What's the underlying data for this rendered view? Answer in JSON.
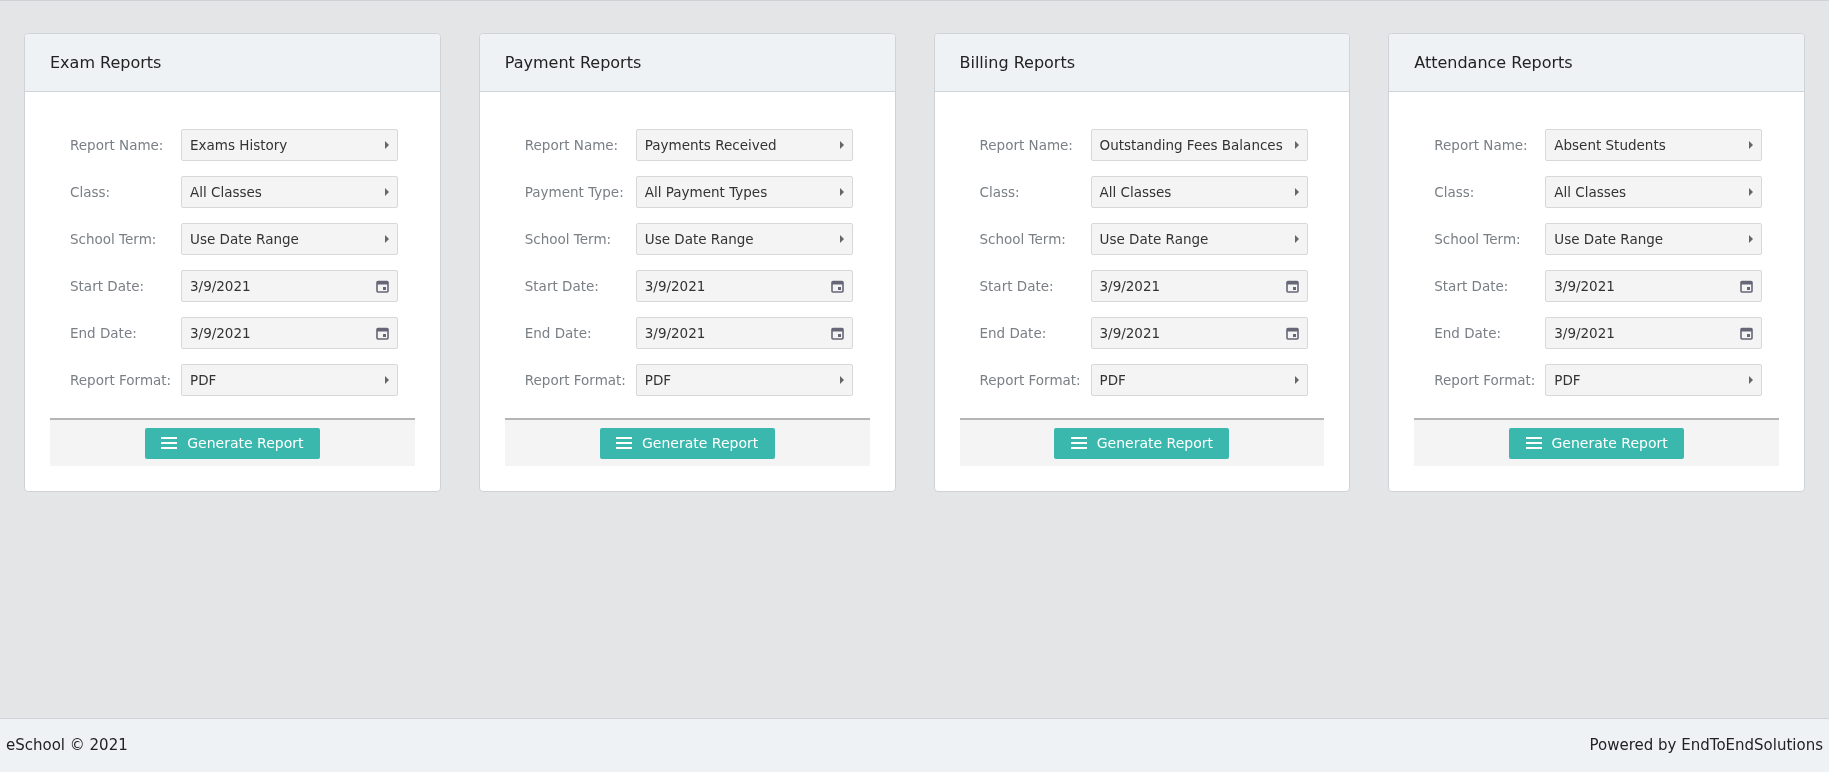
{
  "cards": [
    {
      "title": "Exam Reports",
      "fields": [
        {
          "label": "Report Name:",
          "kind": "select",
          "value": "Exams History"
        },
        {
          "label": "Class:",
          "kind": "select",
          "value": "All Classes"
        },
        {
          "label": "School Term:",
          "kind": "select",
          "value": "Use Date Range"
        },
        {
          "label": "Start Date:",
          "kind": "date",
          "value": "3/9/2021"
        },
        {
          "label": "End Date:",
          "kind": "date",
          "value": "3/9/2021"
        },
        {
          "label": "Report Format:",
          "kind": "select",
          "value": "PDF"
        }
      ],
      "button": "Generate Report"
    },
    {
      "title": "Payment Reports",
      "fields": [
        {
          "label": "Report Name:",
          "kind": "select",
          "value": "Payments Received"
        },
        {
          "label": "Payment Type:",
          "kind": "select",
          "value": "All Payment Types"
        },
        {
          "label": "School Term:",
          "kind": "select",
          "value": "Use Date Range"
        },
        {
          "label": "Start Date:",
          "kind": "date",
          "value": "3/9/2021"
        },
        {
          "label": "End Date:",
          "kind": "date",
          "value": "3/9/2021"
        },
        {
          "label": "Report Format:",
          "kind": "select",
          "value": "PDF"
        }
      ],
      "button": "Generate Report"
    },
    {
      "title": "Billing Reports",
      "fields": [
        {
          "label": "Report Name:",
          "kind": "select",
          "value": "Outstanding Fees Balances"
        },
        {
          "label": "Class:",
          "kind": "select",
          "value": "All Classes"
        },
        {
          "label": "School Term:",
          "kind": "select",
          "value": "Use Date Range"
        },
        {
          "label": "Start Date:",
          "kind": "date",
          "value": "3/9/2021"
        },
        {
          "label": "End Date:",
          "kind": "date",
          "value": "3/9/2021"
        },
        {
          "label": "Report Format:",
          "kind": "select",
          "value": "PDF"
        }
      ],
      "button": "Generate Report"
    },
    {
      "title": "Attendance Reports",
      "fields": [
        {
          "label": "Report Name:",
          "kind": "select",
          "value": "Absent Students"
        },
        {
          "label": "Class:",
          "kind": "select",
          "value": "All Classes"
        },
        {
          "label": "School Term:",
          "kind": "select",
          "value": "Use Date Range"
        },
        {
          "label": "Start Date:",
          "kind": "date",
          "value": "3/9/2021"
        },
        {
          "label": "End Date:",
          "kind": "date",
          "value": "3/9/2021"
        },
        {
          "label": "Report Format:",
          "kind": "select",
          "value": "PDF"
        }
      ],
      "button": "Generate Report"
    }
  ],
  "footer": {
    "copyright": "eSchool © 2021",
    "credit": "Powered by EndToEndSolutions"
  }
}
